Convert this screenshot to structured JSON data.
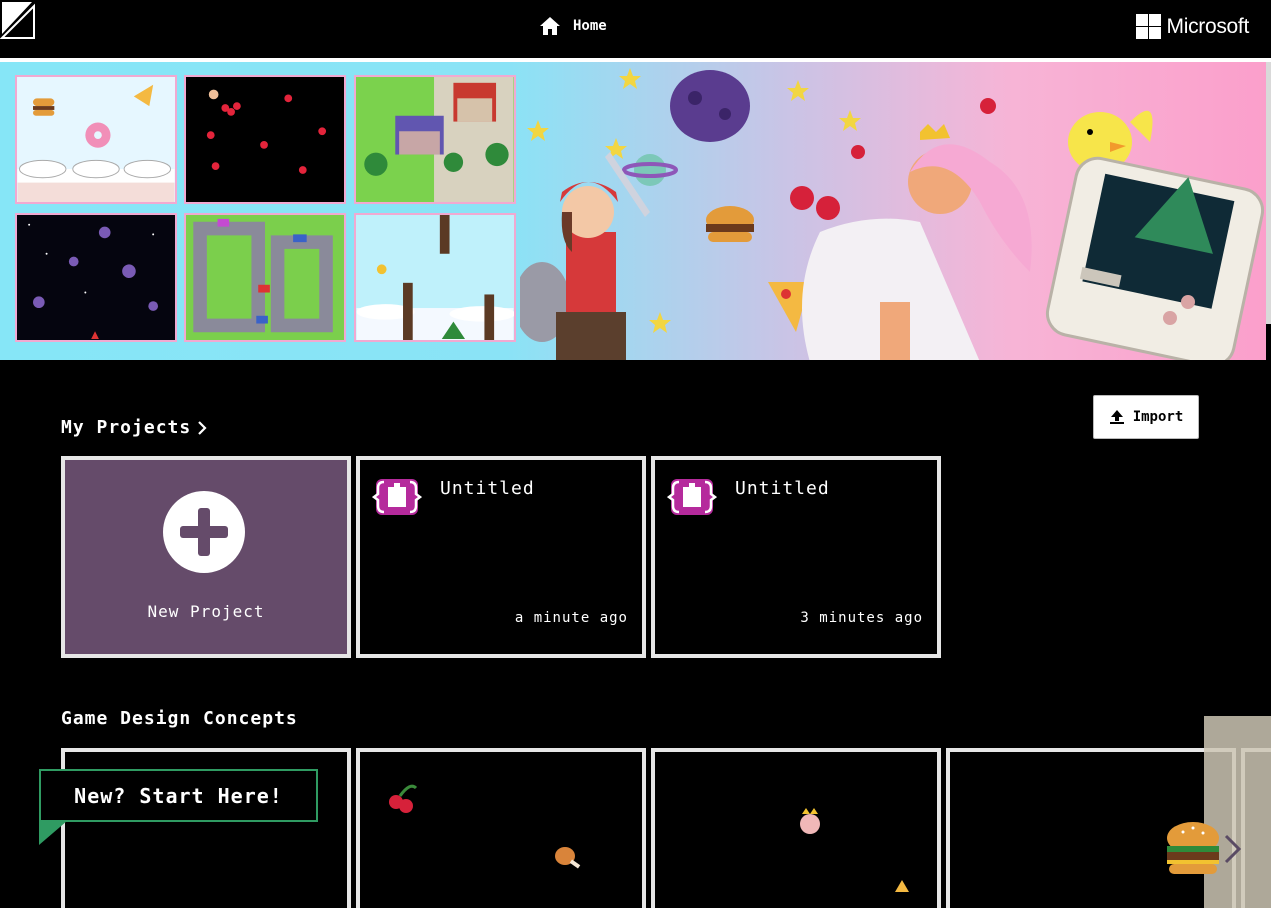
{
  "header": {
    "home_label": "Home",
    "brand": "Microsoft"
  },
  "my_projects": {
    "title": "My Projects",
    "import_label": "Import",
    "new_project_label": "New Project",
    "projects": [
      {
        "title": "Untitled",
        "time": "a minute ago"
      },
      {
        "title": "Untitled",
        "time": "3 minutes ago"
      }
    ]
  },
  "game_design": {
    "title": "Game Design Concepts",
    "callout": "New? Start Here!"
  },
  "colors": {
    "new_project_bg": "#654b6a",
    "callout_border": "#2f9b62",
    "project_icon": "#b52a9c"
  },
  "icons": [
    "corner-logo-icon",
    "home-icon",
    "microsoft-logo-icon",
    "upload-icon",
    "plus-icon",
    "puzzle-project-icon",
    "chevron-right-icon"
  ]
}
